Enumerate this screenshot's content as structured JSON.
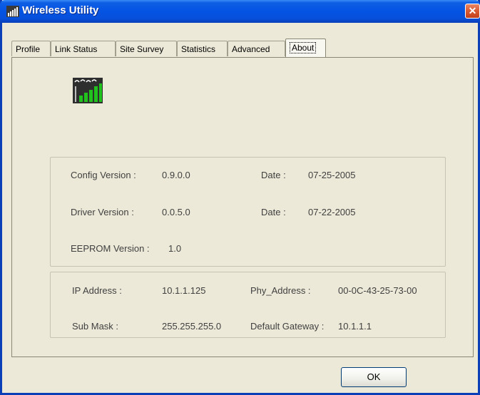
{
  "window": {
    "title": "Wireless Utility",
    "close_glyph": "✕"
  },
  "tabs": [
    {
      "label": "Profile",
      "active": false
    },
    {
      "label": "Link Status",
      "active": false
    },
    {
      "label": "Site Survey",
      "active": false
    },
    {
      "label": "Statistics",
      "active": false
    },
    {
      "label": "Advanced",
      "active": false
    },
    {
      "label": "About",
      "active": true
    }
  ],
  "about": {
    "logo_icon": "wireless-signal-icon",
    "config_version_label": "Config Version :",
    "config_version_value": "0.9.0.0",
    "config_date_label": "Date :",
    "config_date_value": "07-25-2005",
    "driver_version_label": "Driver Version :",
    "driver_version_value": "0.0.5.0",
    "driver_date_label": "Date :",
    "driver_date_value": "07-22-2005",
    "eeprom_version_label": "EEPROM Version :",
    "eeprom_version_value": "1.0"
  },
  "network": {
    "ip_address_label": "IP Address :",
    "ip_address_value": "10.1.1.125",
    "phy_address_label": "Phy_Address :",
    "phy_address_value": "00-0C-43-25-73-00",
    "sub_mask_label": "Sub Mask :",
    "sub_mask_value": "255.255.255.0",
    "gateway_label": "Default Gateway :",
    "gateway_value": "10.1.1.1"
  },
  "buttons": {
    "ok_label": "OK"
  },
  "colors": {
    "titlebar": "#0554e3",
    "window_bg": "#ece9d8",
    "signal_bars": "#22c21e",
    "close_button": "#d85a32"
  }
}
